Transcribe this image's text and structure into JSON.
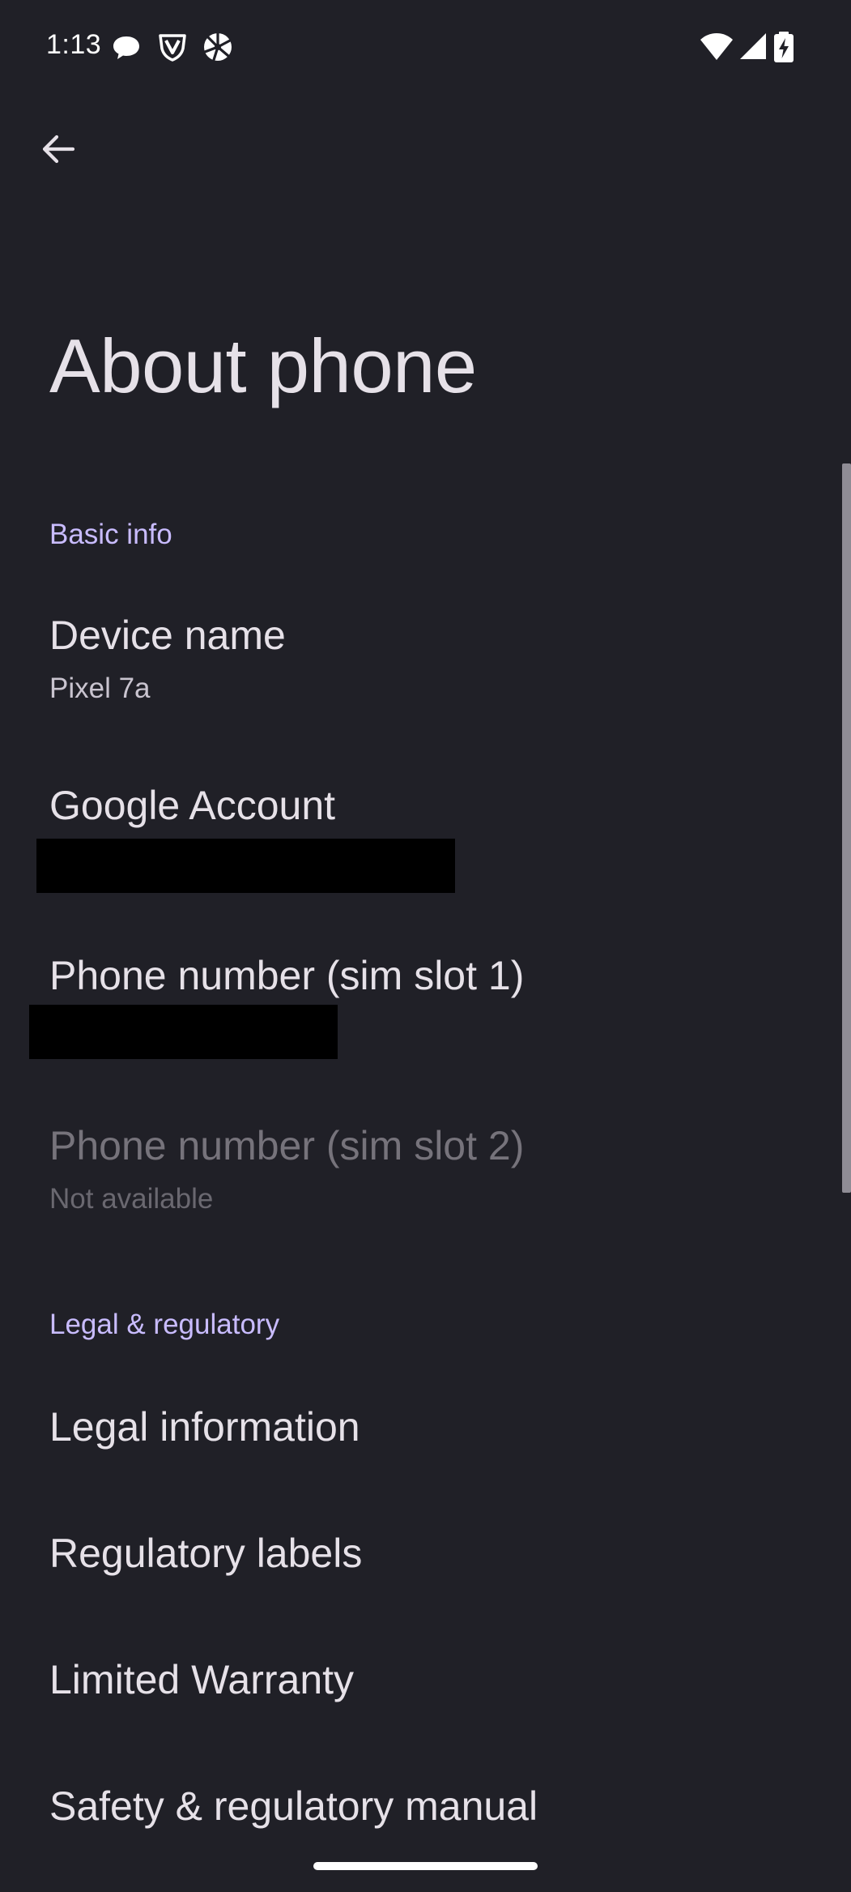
{
  "status_bar": {
    "time": "1:13",
    "left_icons": [
      "chat-bubble-icon",
      "shield-v-icon",
      "aperture-icon"
    ],
    "right_icons": [
      "wifi-icon",
      "cell-signal-icon",
      "battery-charging-icon"
    ]
  },
  "header": {
    "back_icon": "arrow-back-icon",
    "title": "About phone"
  },
  "sections": {
    "basic_info": {
      "header": "Basic info",
      "device_name": {
        "title": "Device name",
        "summary": "Pixel 7a"
      },
      "google_account": {
        "title": "Google Account",
        "summary_redacted": true
      },
      "phone_sim1": {
        "title": "Phone number (sim slot 1)",
        "summary_redacted": true
      },
      "phone_sim2": {
        "title": "Phone number (sim slot 2)",
        "summary": "Not available",
        "enabled": false
      }
    },
    "legal": {
      "header": "Legal & regulatory",
      "legal_information": {
        "title": "Legal information"
      },
      "regulatory_labels": {
        "title": "Regulatory labels"
      },
      "limited_warranty": {
        "title": "Limited Warranty"
      },
      "safety_manual": {
        "title": "Safety & regulatory manual"
      }
    }
  },
  "colors": {
    "background": "#202027",
    "accent": "#c9bcff",
    "text_primary": "#e6e1e8",
    "text_disabled": "#76737b"
  }
}
